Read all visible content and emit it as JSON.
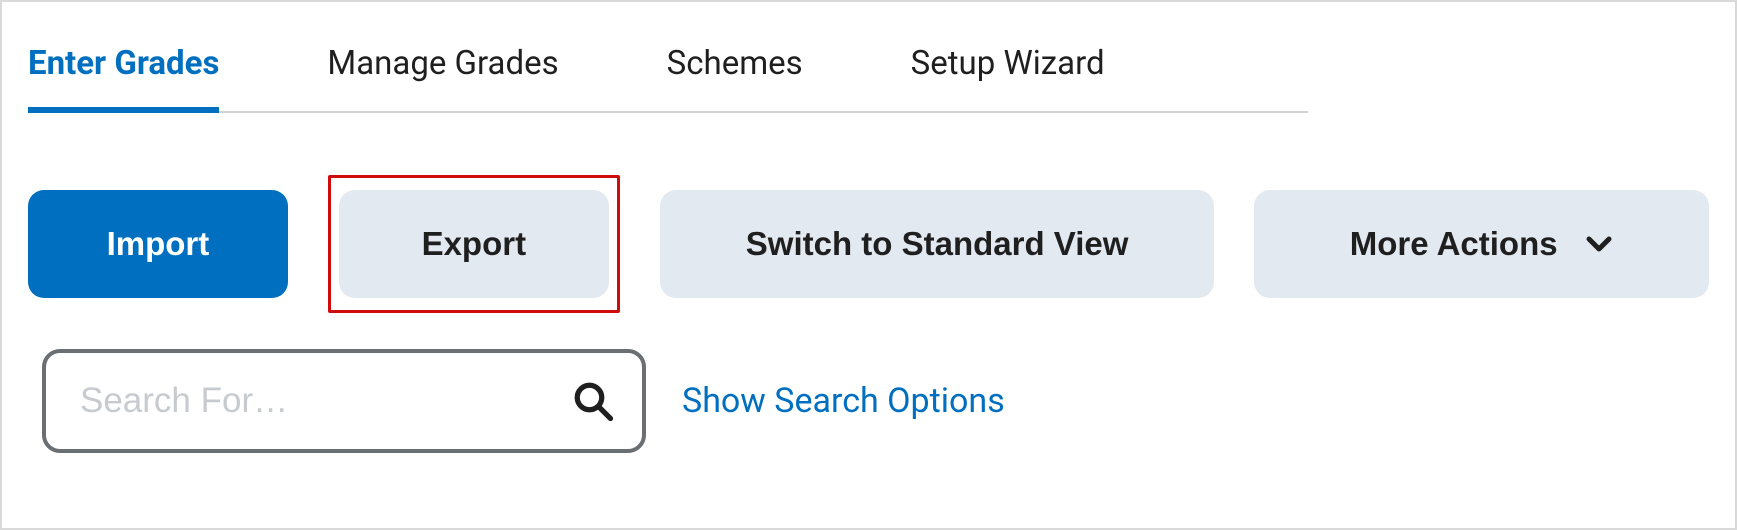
{
  "tabs": {
    "enter_grades": "Enter Grades",
    "manage_grades": "Manage Grades",
    "schemes": "Schemes",
    "setup_wizard": "Setup Wizard"
  },
  "toolbar": {
    "import_label": "Import",
    "export_label": "Export",
    "switch_label": "Switch to Standard View",
    "more_actions_label": "More Actions"
  },
  "search": {
    "placeholder": "Search For…",
    "options_label": "Show Search Options"
  },
  "colors": {
    "accent": "#006fbf",
    "highlight_border": "#cf0b0b",
    "secondary_button_bg": "#e3e9f1"
  }
}
